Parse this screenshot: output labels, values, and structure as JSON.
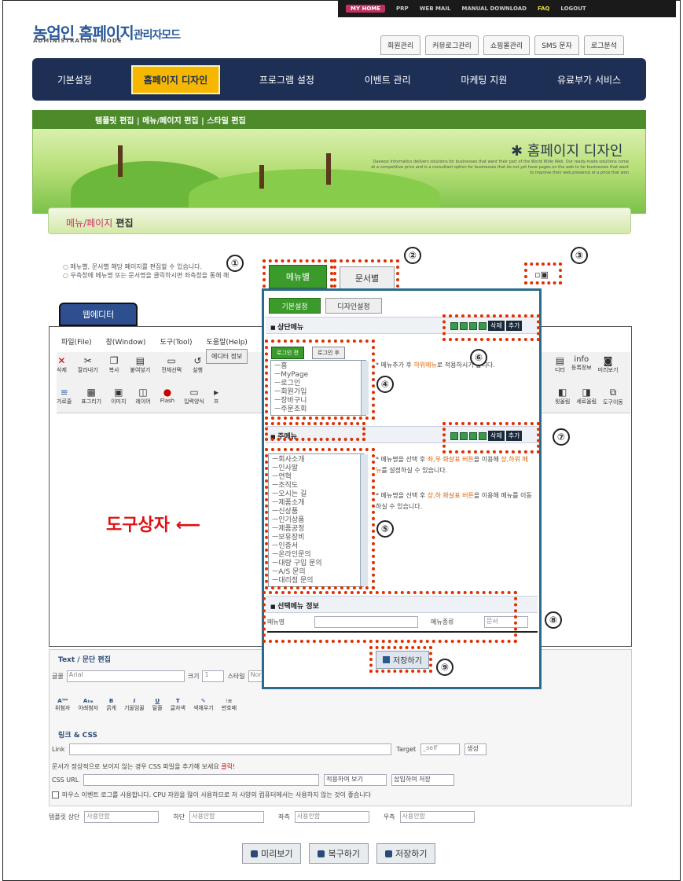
{
  "top": {
    "links": [
      "MY HOME",
      "PRP",
      "WEB MAIL",
      "MANUAL DOWNLOAD",
      "FAQ",
      "LOGOUT"
    ]
  },
  "logo": {
    "title": "농업인 홈페이지",
    "mode": "관리자모드",
    "sub": "ADMINISTRATION MODE"
  },
  "toptabs": [
    "회원관리",
    "커뮤로그관리",
    "쇼핑몰관리",
    "SMS 문자",
    "로그분석"
  ],
  "mainnav": [
    "기본설정",
    "홈페이지 디자인",
    "프로그램 설정",
    "이벤트 관리",
    "마케팅 지원",
    "유료부가 서비스"
  ],
  "subnav": "템플릿 편집  |  메뉴/페이지 편집  |  스타일 편집",
  "banner": {
    "title": "✱ 홈페이지 디자인",
    "text": "Daewoo Informatics delivers solutions for businesses that want their part of the World Wide Web. Our ready-made solutions come at a competitive price and is a consultant option for businesses that do not yet have pages on the web to for businesses that want to improve their web presence at a price that won"
  },
  "section": {
    "title_a": "메뉴/페이지",
    "title_b": " 편집"
  },
  "desc": {
    "line1": "메뉴별, 문서별 해당 페이지를 편집할 수 있습니다.",
    "line2": "우측창에 메뉴명 또는 문서명을 클릭하시면 좌측창을 통해 해"
  },
  "tabs": {
    "menu": "메뉴별",
    "doc": "문서별"
  },
  "editor": {
    "tab": "웹에디터",
    "menus": [
      "파일(File)",
      "창(Window)",
      "도구(Tool)",
      "도움말(Help)"
    ],
    "info": "에디터 정보",
    "tools1": [
      "삭제",
      "잘라내기",
      "복사",
      "붙여넣기",
      "전체선택",
      "실행"
    ],
    "tools2": [
      "가로줄",
      "표그리기",
      "이미지",
      "레이어",
      "Flash",
      "입력양식",
      "프"
    ],
    "rtools1": [
      "디터",
      "등록정보",
      "미리보기"
    ],
    "rtools2": [
      "윗올림",
      "세로올림",
      "도구이동"
    ]
  },
  "callouts": {
    "toolbox": "도구상자"
  },
  "popup": {
    "tab1": "기본설정",
    "tab2": "디자인설정",
    "topmenu": "상단메뉴",
    "login_before": "로그인 전",
    "login_after": "로그인 후",
    "top_items": [
      "ㅡ홈",
      "ㅡMyPage",
      "ㅡ로그인",
      "ㅡ회원가입",
      "ㅡ장바구니",
      "ㅡ주문조회"
    ],
    "note1_a": "* 메뉴추가 후 ",
    "note1_b": "하위메뉴",
    "note1_c": "로 적용하시기 합니다.",
    "submenu": "주메뉴",
    "sub_items": [
      "ㅡ회사소개",
      "ㅡ인사말",
      "ㅡ연혁",
      "ㅡ조직도",
      "ㅡ오시는 길",
      "ㅡ제품소개",
      "ㅡ신상품",
      "ㅡ인기상품",
      "ㅡ제품공정",
      "ㅡ보유장비",
      "ㅡ인증서",
      "ㅡ온라인문의",
      "ㅡ대량 구입 문의",
      "ㅡA/S 문의",
      "ㅡ대리점 문의"
    ],
    "note2_a": "* 메뉴명을 선택 후 ",
    "note2_b": "좌,우 화살표 버튼",
    "note2_c": "을 이용해 ",
    "note2_d": "상,하위 메뉴",
    "note2_e": "를 설정하실 수 있습니다.",
    "note3_a": "* 메뉴명을 선택 후 ",
    "note3_b": "상,하 화살표 버튼",
    "note3_c": "을 이용해 메뉴를 이동하실 수 있습니다.",
    "del": "삭제",
    "add": "추가",
    "selinfo": "선택메뉴 정보",
    "menuname": "메뉴명",
    "menutype": "메뉴종류",
    "menutype_val": "문서",
    "save": "저장하기"
  },
  "numbers": [
    "①",
    "②",
    "③",
    "④",
    "⑤",
    "⑥",
    "⑦",
    "⑧",
    "⑨"
  ],
  "textedit": {
    "title": "Text / 문단 편집",
    "font_label": "글꼴",
    "font_val": "Arial",
    "size_label": "크기",
    "size_val": "1",
    "style_label": "스타일",
    "style_val": "Nor",
    "tools": [
      "위첨자",
      "아래첨자",
      "굵게",
      "기울임꼴",
      "밑줄",
      "글자색",
      "색채우기",
      "번호매"
    ]
  },
  "link": {
    "title": "링크 & CSS",
    "link_label": "Link",
    "target_label": "Target",
    "target_val": "_self",
    "make": "생성",
    "css_note_a": "문서가 정상적으로 보이지 않는 경우 CSS 파일을 추가해 보세요 ",
    "css_note_b": "클릭!",
    "css_label": "CSS URL",
    "apply": "적용하여 보기",
    "insert": "삽입하여 저장",
    "mouse": "마우스 이벤트 로그를 사용합니다. CPU 자원을 많이 사용하므로 저 사양의 컴퓨터에서는 사용하지 않는 것이 좋습니다"
  },
  "template": {
    "top_label": "템플릿 상단",
    "top": "사용안함",
    "bottom_label": "하단",
    "bottom": "사용안함",
    "left_label": "좌측",
    "left": "사용안함",
    "right_label": "우측",
    "right": "사용안함"
  },
  "footer": {
    "preview": "미리보기",
    "restore": "복구하기",
    "save": "저장하기"
  }
}
